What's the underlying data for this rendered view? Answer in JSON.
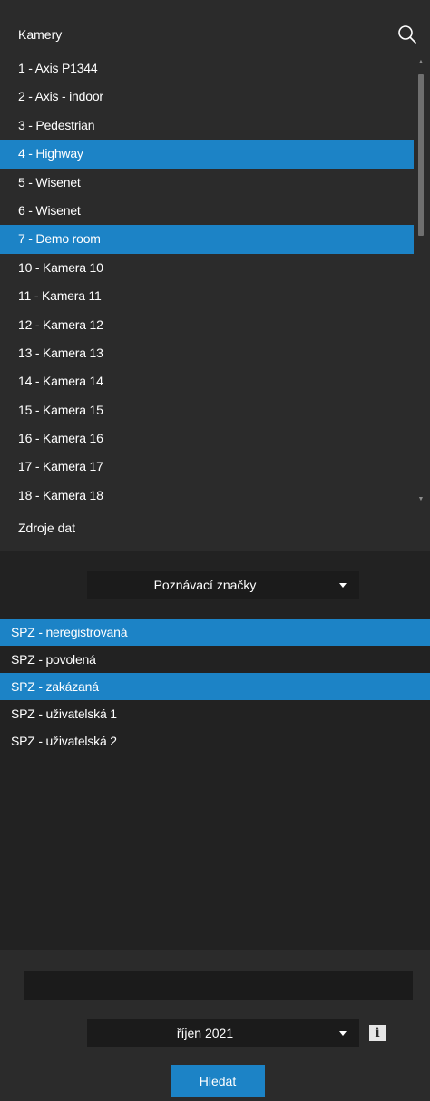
{
  "cameras": {
    "title": "Kamery",
    "search_icon": "search-icon",
    "items": [
      {
        "label": "1 - Axis P1344",
        "selected": false
      },
      {
        "label": "2 - Axis - indoor",
        "selected": false
      },
      {
        "label": "3 - Pedestrian",
        "selected": false
      },
      {
        "label": "4 - Highway",
        "selected": true
      },
      {
        "label": "5 - Wisenet",
        "selected": false
      },
      {
        "label": "6 - Wisenet",
        "selected": false
      },
      {
        "label": "7 - Demo room",
        "selected": true
      },
      {
        "label": "10 - Kamera 10",
        "selected": false
      },
      {
        "label": "11 - Kamera 11",
        "selected": false
      },
      {
        "label": "12 - Kamera 12",
        "selected": false
      },
      {
        "label": "13 - Kamera 13",
        "selected": false
      },
      {
        "label": "14 - Kamera 14",
        "selected": false
      },
      {
        "label": "15 - Kamera 15",
        "selected": false
      },
      {
        "label": "16 - Kamera 16",
        "selected": false
      },
      {
        "label": "17 - Kamera 17",
        "selected": false
      },
      {
        "label": "18 - Kamera 18",
        "selected": false
      }
    ]
  },
  "data_sources": {
    "label": "Zdroje dat",
    "dropdown_value": "Poznávací značky"
  },
  "plates": {
    "items": [
      {
        "label": "SPZ - neregistrovaná",
        "selected": true
      },
      {
        "label": "SPZ - povolená",
        "selected": false
      },
      {
        "label": "SPZ - zakázaná",
        "selected": true
      },
      {
        "label": "SPZ - uživatelská 1",
        "selected": false
      },
      {
        "label": "SPZ - uživatelská 2",
        "selected": false
      }
    ]
  },
  "filter": {
    "text_value": "",
    "month_value": "říjen 2021",
    "info_icon": "info-icon",
    "search_button": "Hledat"
  },
  "colors": {
    "background": "#2b2b2b",
    "panel_dark": "#222222",
    "field": "#1b1b1b",
    "accent": "#1c83c6"
  }
}
